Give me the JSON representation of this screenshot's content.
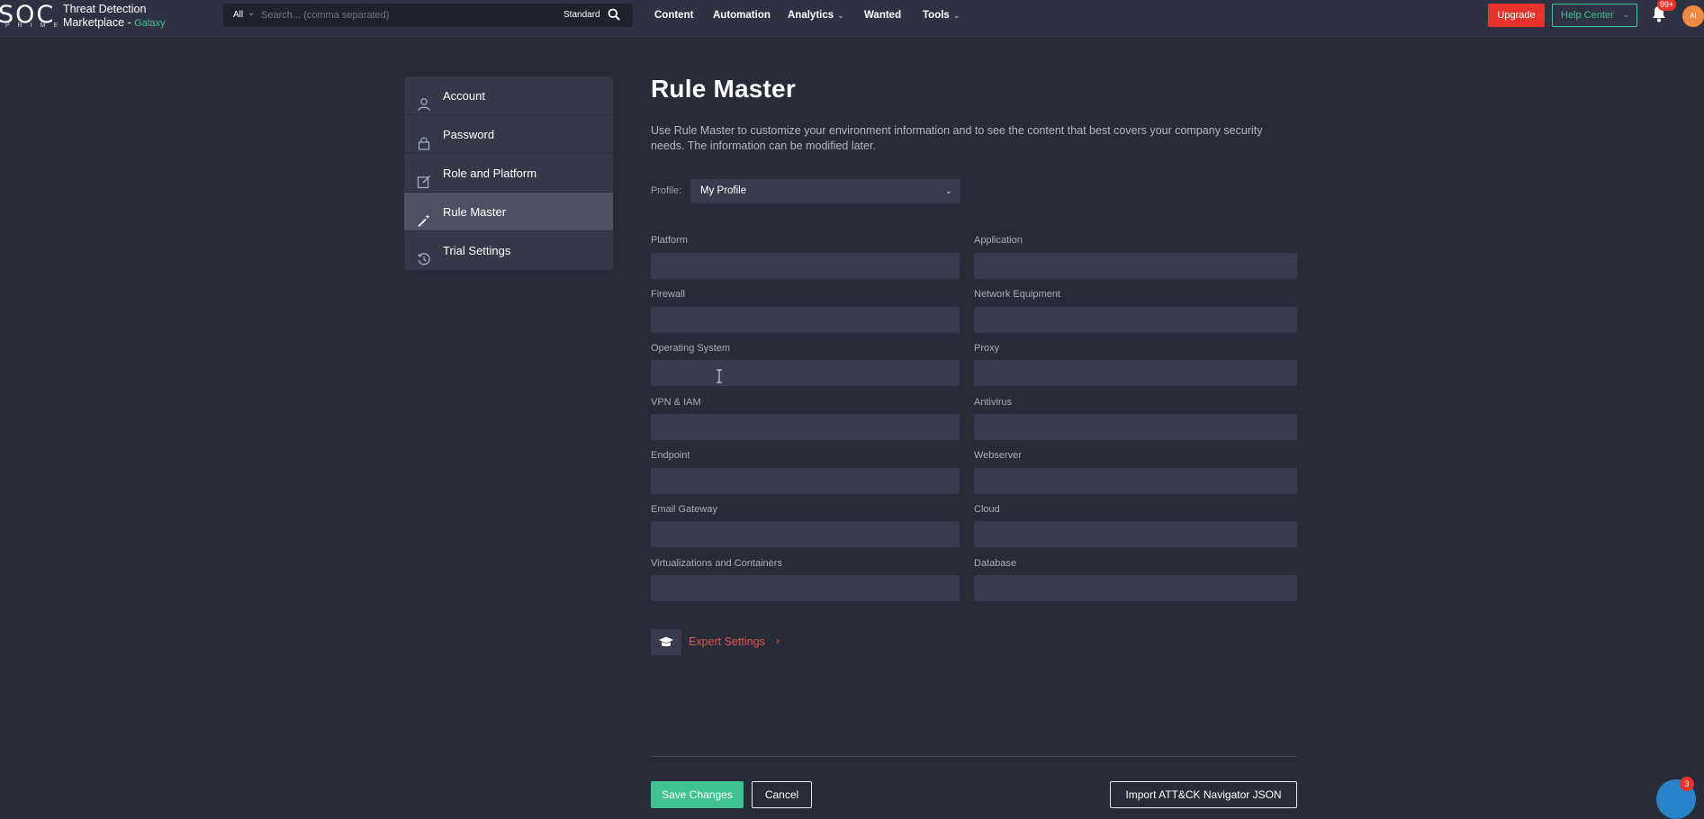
{
  "header": {
    "logo_text": "SOC",
    "logo_sub": "PRIME",
    "brand_line1": "Threat Detection",
    "brand_line2": "Marketplace -",
    "brand_galaxy": "Galaxy",
    "search": {
      "scope": "All",
      "placeholder": "Search... (comma separated)",
      "mode": "Standard"
    },
    "nav": [
      {
        "label": "Content"
      },
      {
        "label": "Automation"
      },
      {
        "label": "Analytics"
      },
      {
        "label": "Wanted"
      },
      {
        "label": "Tools"
      }
    ],
    "upgrade_label": "Upgrade",
    "help_label": "Help Center",
    "notification_count": "99+",
    "avatar_initials": "AI"
  },
  "sidebar": {
    "items": [
      {
        "label": "Account",
        "icon": "user-icon"
      },
      {
        "label": "Password",
        "icon": "lock-icon"
      },
      {
        "label": "Role and Platform",
        "icon": "edit-icon"
      },
      {
        "label": "Rule Master",
        "icon": "magic-wand-icon",
        "active": true
      },
      {
        "label": "Trial Settings",
        "icon": "history-icon"
      }
    ]
  },
  "main": {
    "title": "Rule Master",
    "description": "Use Rule Master to customize your environment information and to see the content that best covers your company security needs. The information can be modified later.",
    "profile_label": "Profile:",
    "profile_value": "My Profile",
    "fields": {
      "platform": {
        "label": "Platform",
        "value": ""
      },
      "application": {
        "label": "Application",
        "value": ""
      },
      "firewall": {
        "label": "Firewall",
        "value": ""
      },
      "network_equipment": {
        "label": "Network Equipment",
        "value": ""
      },
      "operating_system": {
        "label": "Operating System",
        "value": ""
      },
      "proxy": {
        "label": "Proxy",
        "value": ""
      },
      "vpn_iam": {
        "label": "VPN & IAM",
        "value": ""
      },
      "antivirus": {
        "label": "Antivirus",
        "value": ""
      },
      "endpoint": {
        "label": "Endpoint",
        "value": ""
      },
      "webserver": {
        "label": "Webserver",
        "value": ""
      },
      "email_gateway": {
        "label": "Email Gateway",
        "value": ""
      },
      "cloud": {
        "label": "Cloud",
        "value": ""
      },
      "virtualizations": {
        "label": "Virtualizations and Containers",
        "value": ""
      },
      "database": {
        "label": "Database",
        "value": ""
      }
    },
    "expert_label": "Expert Settings",
    "save_label": "Save Changes",
    "cancel_label": "Cancel",
    "import_label": "Import ATT&CK Navigator JSON"
  },
  "chat_badge": "3",
  "colors": {
    "background": "#282b38",
    "topbar": "#2f3242",
    "accent_green": "#3ec28f",
    "danger_red": "#e8322c",
    "expert_link": "#e2564b"
  }
}
